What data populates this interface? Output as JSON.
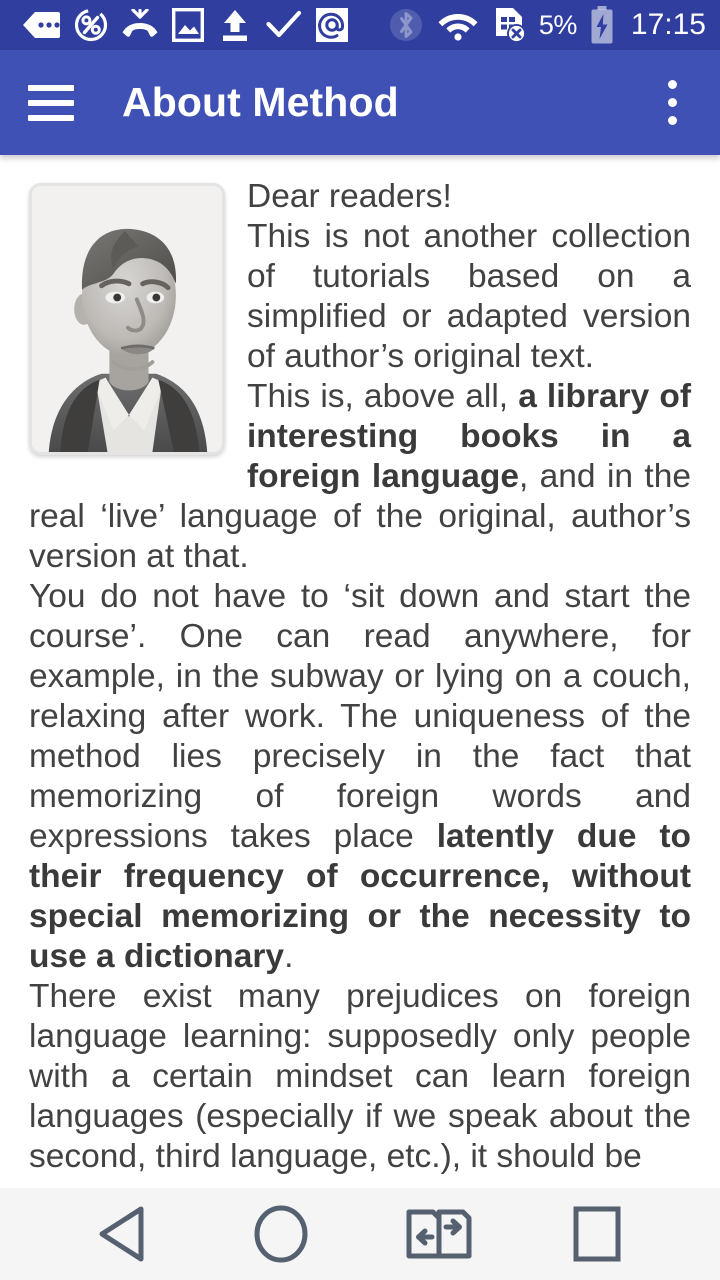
{
  "status_bar": {
    "left_icons": [
      {
        "name": "message-bubble-icon",
        "label": "messages"
      },
      {
        "name": "percent-circle-icon",
        "label": "data-saver-percent"
      },
      {
        "name": "missed-call-icon",
        "label": "missed call"
      },
      {
        "name": "image-icon",
        "label": "screenshot / image"
      },
      {
        "name": "upload-icon",
        "label": "upload"
      },
      {
        "name": "checkmark-icon",
        "label": "check"
      },
      {
        "name": "email-at-icon",
        "label": "email"
      }
    ],
    "right_icons": [
      {
        "name": "bluetooth-icon",
        "label": "bluetooth"
      },
      {
        "name": "wifi-icon",
        "label": "wifi"
      },
      {
        "name": "no-sim-icon",
        "label": "no sim card"
      }
    ],
    "battery_percent": "5%",
    "battery_charging": true,
    "clock": "17:15"
  },
  "app_bar": {
    "menu_icon": "hamburger-menu-icon",
    "title": "About Method",
    "overflow_icon": "overflow-menu-icon"
  },
  "article": {
    "portrait_alt": "author portrait",
    "paragraphs": [
      {
        "id": "greeting",
        "runs": [
          {
            "text": "Dear readers!",
            "bold": false
          }
        ]
      },
      {
        "id": "intro",
        "runs": [
          {
            "text": "This is not another collection of tutorials based on a simplified or adapted version of author’s original text.",
            "bold": false
          }
        ]
      },
      {
        "id": "library",
        "runs": [
          {
            "text": "This is, above all, ",
            "bold": false
          },
          {
            "text": "a library of interesting books in a foreign language",
            "bold": true
          },
          {
            "text": ", and in the real ‘live’ language of the original, author’s version at that.",
            "bold": false
          }
        ]
      },
      {
        "id": "method",
        "runs": [
          {
            "text": "You do not have to ‘sit down and start the course’. One can read anywhere, for example, in the subway or lying on a couch, relaxing after work. The uniqueness of the method lies precisely in the fact that memorizing of foreign words and expressions takes place ",
            "bold": false
          },
          {
            "text": "latently due to their frequency of occurrence, without special memorizing or the necessity to use a dictionary",
            "bold": true
          },
          {
            "text": ".",
            "bold": false
          }
        ]
      },
      {
        "id": "prejudices",
        "runs": [
          {
            "text": "There exist many prejudices on foreign language learning: supposedly only people with a certain mindset can learn foreign languages (especially if we speak about the second, third language, etc.), it should be",
            "bold": false
          }
        ]
      }
    ]
  },
  "nav_bar": {
    "buttons": [
      {
        "name": "back-button",
        "icon": "back-triangle-icon",
        "label": "Back"
      },
      {
        "name": "home-button",
        "icon": "home-circle-icon",
        "label": "Home"
      },
      {
        "name": "switch-apps-button",
        "icon": "switch-apps-icon",
        "label": "Switch apps"
      },
      {
        "name": "recents-button",
        "icon": "recents-square-icon",
        "label": "Recents"
      }
    ]
  },
  "colors": {
    "status_bar_bg": "#303F9F",
    "app_bar_bg": "#3F51B5",
    "content_bg": "#FFFFFF",
    "text": "#424242",
    "nav_bar_bg": "#F5F5F5",
    "nav_icon": "#556070"
  }
}
